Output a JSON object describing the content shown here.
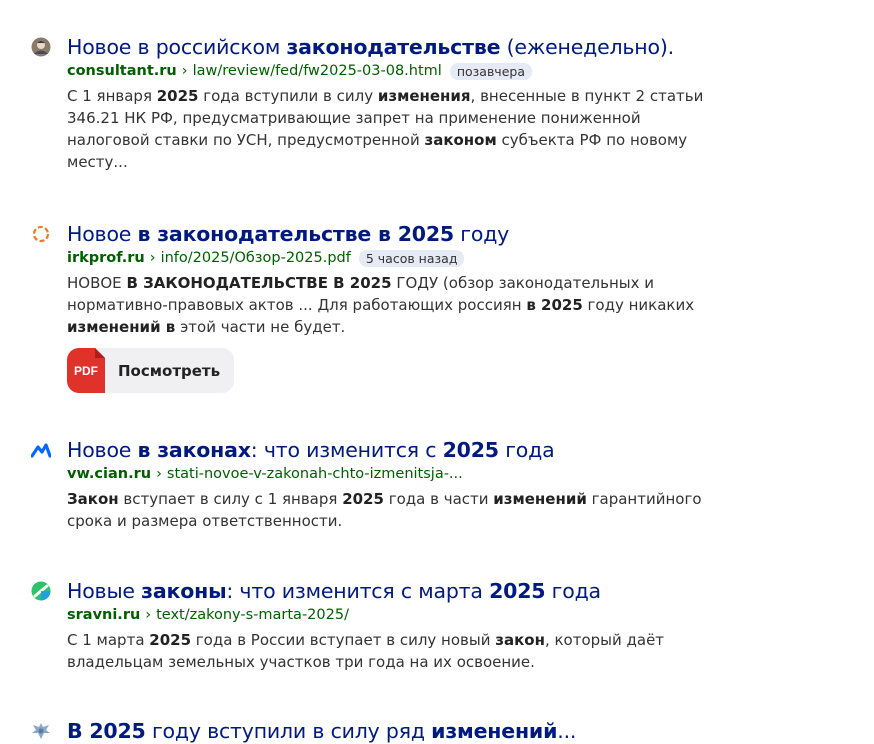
{
  "results": [
    {
      "favicon": "consultant-avatar-icon",
      "title": [
        {
          "t": "Новое в российском ",
          "b": false
        },
        {
          "t": "законодательстве",
          "b": true
        },
        {
          "t": " (еженедельно).",
          "b": false
        }
      ],
      "domain": "consultant.ru",
      "path": "law/review/fed/fw2025-03-08.html",
      "badge": "позавчера",
      "snippet_lines": [
        [
          {
            "t": "С 1 января ",
            "b": false
          },
          {
            "t": "2025",
            "b": true
          },
          {
            "t": " года вступили в силу ",
            "b": false
          },
          {
            "t": "изменения",
            "b": true
          },
          {
            "t": ", внесенные в пункт 2 статьи",
            "b": false
          }
        ],
        [
          {
            "t": "346.21 НК РФ, предусматривающие запрет на применение пониженной",
            "b": false
          }
        ],
        [
          {
            "t": "налоговой ставки по УСН, предусмотренной ",
            "b": false
          },
          {
            "t": "законом",
            "b": true
          },
          {
            "t": " субъекта РФ по новому",
            "b": false
          }
        ],
        [
          {
            "t": "месту...",
            "b": false
          }
        ]
      ]
    },
    {
      "favicon": "irkprof-ring-icon",
      "title": [
        {
          "t": "Новое ",
          "b": false
        },
        {
          "t": "в законодательстве в 2025",
          "b": true
        },
        {
          "t": " году",
          "b": false
        }
      ],
      "domain": "irkprof.ru",
      "path": "info/2025/Обзор-2025.pdf",
      "badge": "5 часов назад",
      "snippet_lines": [
        [
          {
            "t": "НОВОЕ ",
            "b": false
          },
          {
            "t": "В ЗАКОНОДАТЕЛЬСТВЕ В 2025",
            "b": true
          },
          {
            "t": " ГОДУ (обзор законодательных и",
            "b": false
          }
        ],
        [
          {
            "t": "нормативно-правовых актов ... Для работающих россиян ",
            "b": false
          },
          {
            "t": "в 2025",
            "b": true
          },
          {
            "t": " году никаких",
            "b": false
          }
        ],
        [
          {
            "t": "изменений в",
            "b": true
          },
          {
            "t": " этой части не будет.",
            "b": false
          }
        ]
      ],
      "pdf": {
        "icon_text": "PDF",
        "label": "Посмотреть"
      }
    },
    {
      "favicon": "cian-logo-icon",
      "title": [
        {
          "t": "Новое ",
          "b": false
        },
        {
          "t": "в законах",
          "b": true
        },
        {
          "t": ": что изменится с ",
          "b": false
        },
        {
          "t": "2025",
          "b": true
        },
        {
          "t": " года",
          "b": false
        }
      ],
      "domain": "vw.cian.ru",
      "path": "stati-novoe-v-zakonah-chto-izmenitsja-...",
      "badge": "",
      "snippet_lines": [
        [
          {
            "t": "Закон",
            "b": true
          },
          {
            "t": " вступает в силу с 1 января ",
            "b": false
          },
          {
            "t": "2025",
            "b": true
          },
          {
            "t": " года в части ",
            "b": false
          },
          {
            "t": "изменений",
            "b": true
          },
          {
            "t": " гарантийного",
            "b": false
          }
        ],
        [
          {
            "t": "срока и размера ответственности.",
            "b": false
          }
        ]
      ]
    },
    {
      "favicon": "sravni-logo-icon",
      "title": [
        {
          "t": "Новые ",
          "b": false
        },
        {
          "t": "законы",
          "b": true
        },
        {
          "t": ": что изменится с марта ",
          "b": false
        },
        {
          "t": "2025",
          "b": true
        },
        {
          "t": " года",
          "b": false
        }
      ],
      "domain": "sravni.ru",
      "path": "text/zakony-s-marta-2025/",
      "badge": "",
      "snippet_lines": [
        [
          {
            "t": "С 1 марта ",
            "b": false
          },
          {
            "t": "2025",
            "b": true
          },
          {
            "t": " года в России вступает в силу новый ",
            "b": false
          },
          {
            "t": "закон",
            "b": true
          },
          {
            "t": ", который даёт",
            "b": false
          }
        ],
        [
          {
            "t": "владельцам земельных участков три года на их освоение.",
            "b": false
          }
        ]
      ]
    },
    {
      "favicon": "emblem-eagle-icon",
      "title": [
        {
          "t": "В 2025",
          "b": true
        },
        {
          "t": " году вступили в силу ряд ",
          "b": false
        },
        {
          "t": "изменений",
          "b": true
        },
        {
          "t": "...",
          "b": false
        }
      ],
      "domain": "",
      "path": "",
      "badge": "",
      "snippet_lines": []
    }
  ],
  "colors": {
    "title": "#001a80",
    "url": "#006000",
    "badge_bg": "#e6eaf5",
    "pdf_red": "#e0322b"
  }
}
